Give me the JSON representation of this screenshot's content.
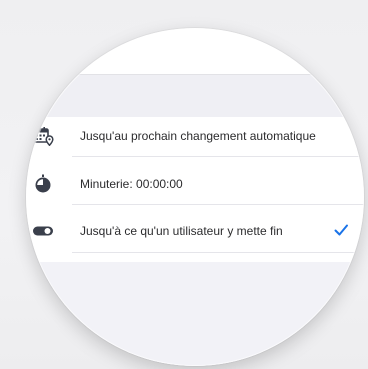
{
  "options": [
    {
      "label": "Jusqu'au prochain changement automatique",
      "icon": "calendar-location-icon",
      "selected": false
    },
    {
      "label": "Minuterie:  00:00:00",
      "icon": "timer-icon",
      "selected": false
    },
    {
      "label": "Jusqu'à ce qu'un utilisateur y mette fin",
      "icon": "toggle-icon",
      "selected": true
    }
  ],
  "colors": {
    "accent": "#1a73e8",
    "icon": "#3a3f4b",
    "text": "#2c2c2e",
    "divider": "#e5e5ea",
    "section_bg": "#efeff4"
  }
}
